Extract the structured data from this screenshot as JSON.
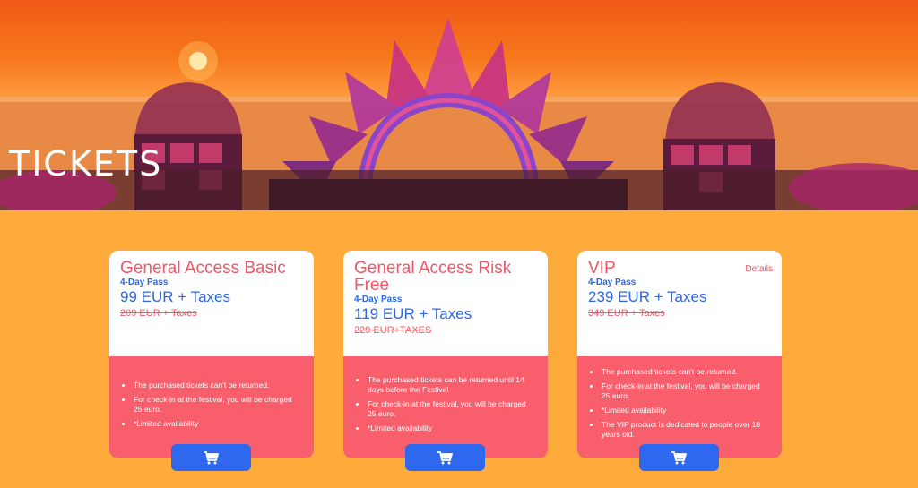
{
  "hero": {
    "title": "TICKETS"
  },
  "cards": [
    {
      "title": "General Access Basic",
      "pass": "4-Day Pass",
      "price": "99 EUR + Taxes",
      "old_price": "209 EUR + Taxes",
      "details": "",
      "features": [
        "The purchased tickets can't be returned.",
        "For check-in at the festival, you will be charged 25 euro.",
        "*Limited availability"
      ]
    },
    {
      "title": "General Access Risk Free",
      "pass": "4-Day Pass",
      "price": "119 EUR + Taxes",
      "old_price": "229 EUR+TAXES",
      "details": "",
      "features": [
        "The purchased tickets can be returned until 14 days before the Festival",
        "For check-in at the festival, you will be charged 25 euro.",
        "*Limited availability"
      ]
    },
    {
      "title": "VIP",
      "pass": "4-Day Pass",
      "price": "239 EUR + Taxes",
      "old_price": "349 EUR + Taxes",
      "details": "Details",
      "features": [
        "The purchased tickets can't be returned.",
        "For check-in at the festival, you will be charged 25 euro.",
        "*Limited availability",
        "The VIP product is dedicated to people over 18 years old."
      ]
    }
  ],
  "colors": {
    "page_background": "#ffab3b",
    "accent_pink": "#f95e6c",
    "accent_blue": "#2d68ee"
  },
  "icons": {
    "cart": "shopping-cart-icon"
  }
}
